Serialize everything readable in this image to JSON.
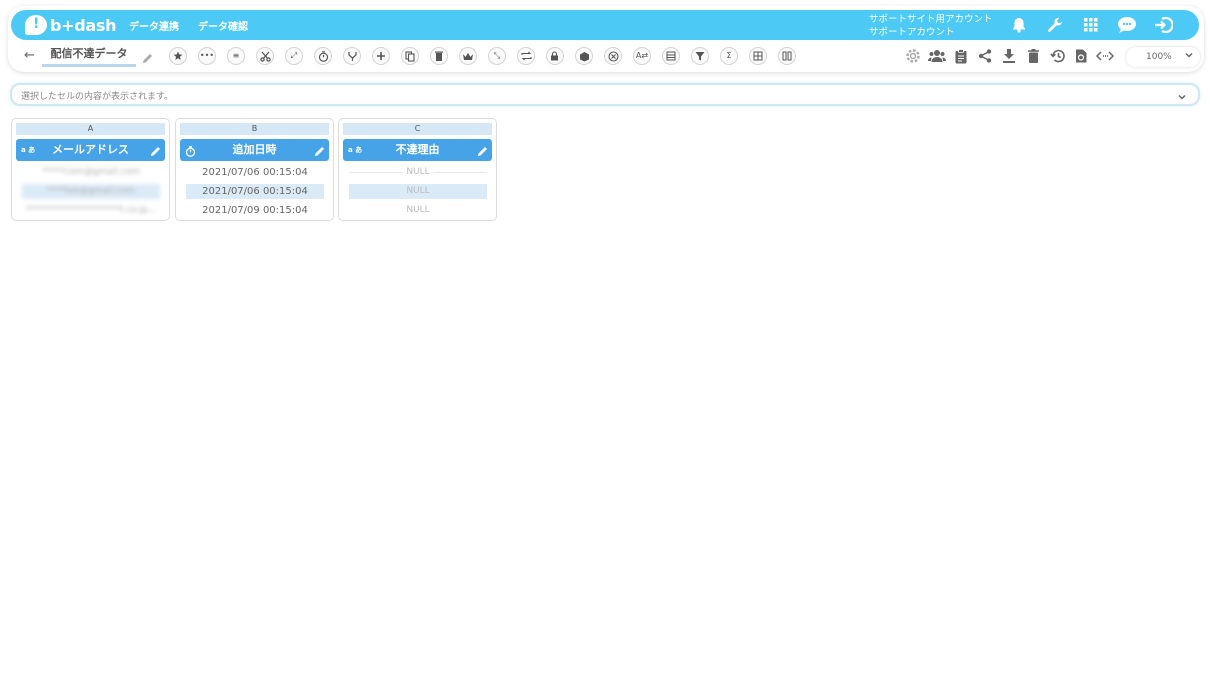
{
  "app": {
    "logo_text": "b+dash",
    "nav": [
      "データ連携",
      "データ確認"
    ],
    "account_line1": "サポートサイト用アカウント",
    "account_line2": "サポートアカウント",
    "top_icons": [
      "bell-icon",
      "wrench-icon",
      "grid-icon",
      "chat-icon",
      "logout-icon"
    ]
  },
  "toolbar": {
    "title": "配信不達データ",
    "tools": [
      "star",
      "more",
      "menu",
      "scissors",
      "expand",
      "timer",
      "branch",
      "plus",
      "copy",
      "delete",
      "crown",
      "shrink",
      "repeat",
      "lock",
      "box",
      "close",
      "replace",
      "table",
      "filter",
      "sum",
      "grid",
      "columns"
    ],
    "right_icons": [
      "gear-icon",
      "users-icon",
      "clipboard-icon",
      "share-icon",
      "download-icon",
      "trash-icon",
      "history-icon",
      "refresh-doc-icon",
      "code-icon"
    ],
    "zoom": "100%"
  },
  "cell_bar": {
    "placeholder": "選択したセルの内容が表示されます。"
  },
  "columns": [
    {
      "letter": "A",
      "type_label": "aあ",
      "header": "メールアドレス",
      "cells": [
        "*****com@gmail.com",
        "****tok@gmail.com",
        "*********************t.co.jp..."
      ]
    },
    {
      "letter": "B",
      "type_label": "timer",
      "header": "追加日時",
      "cells": [
        "2021/07/06 00:15:04",
        "2021/07/06 00:15:04",
        "2021/07/09 00:15:04"
      ]
    },
    {
      "letter": "C",
      "type_label": "a あ",
      "header": "不達理由",
      "cells": [
        "NULL",
        "NULL",
        "NULL"
      ]
    }
  ],
  "colors": {
    "brand": "#4dc9f6",
    "column_header": "#47a3e8",
    "column_letter_bg": "#d6e8f5",
    "alt_row": "#dbeaf7"
  }
}
